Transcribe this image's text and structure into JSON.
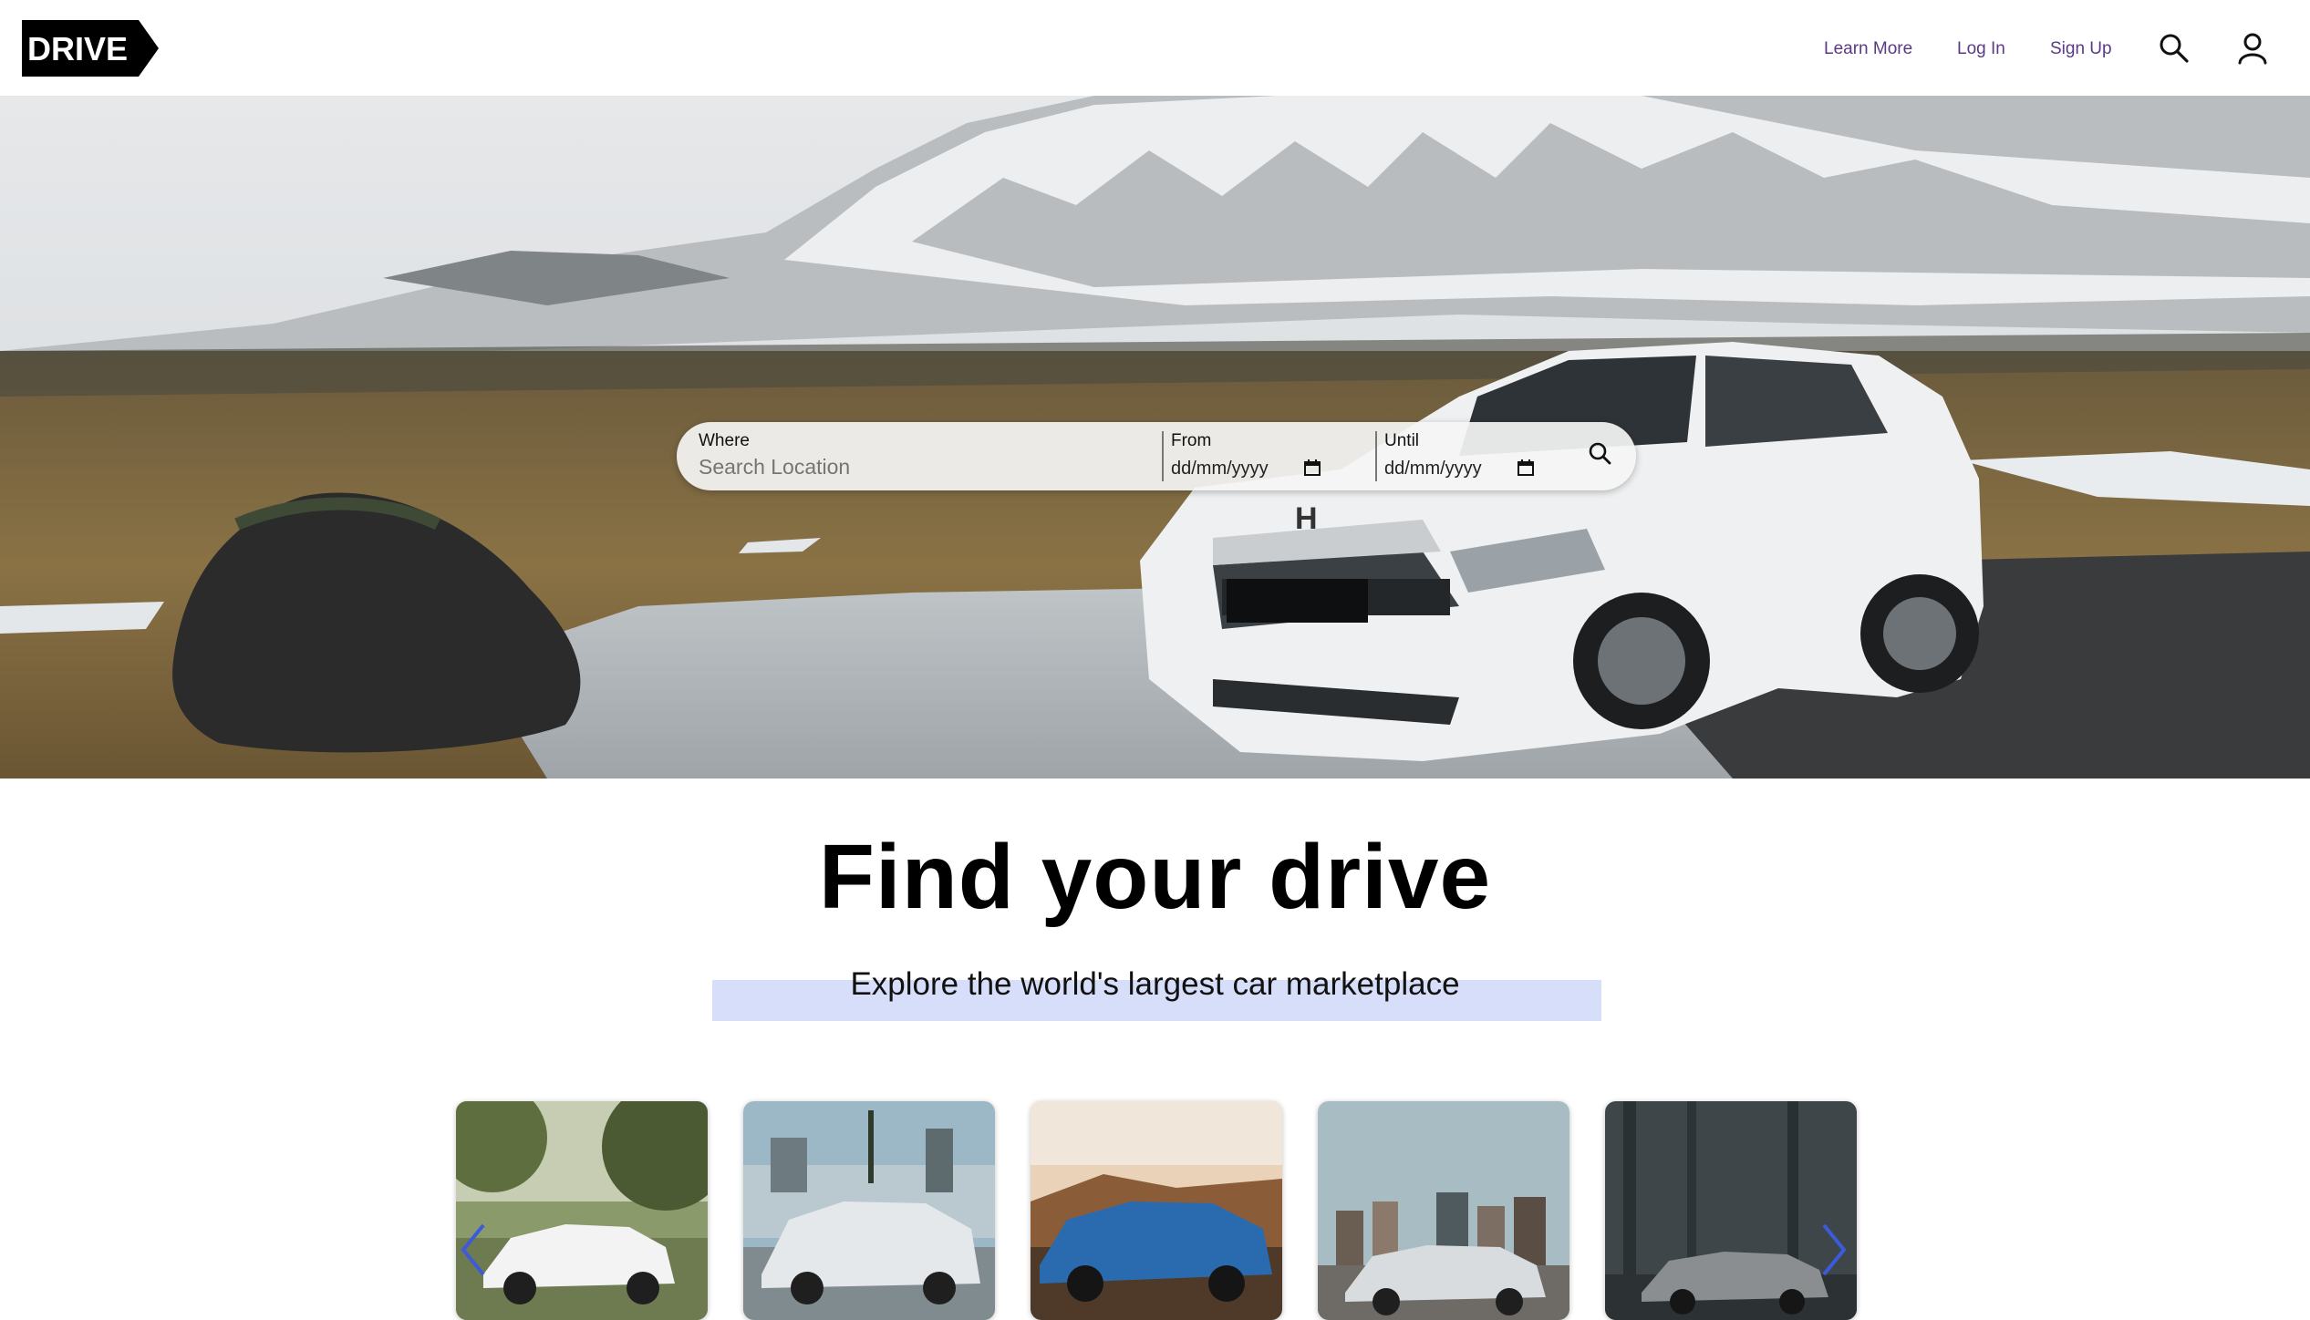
{
  "header": {
    "logo_text": "DRIVE",
    "nav": {
      "learn_more": "Learn More",
      "log_in": "Log In",
      "sign_up": "Sign Up"
    },
    "icons": [
      "search-icon",
      "user-icon"
    ],
    "link_color": "#5a3a86"
  },
  "search": {
    "where_label": "Where",
    "where_placeholder": "Search Location",
    "from_label": "From",
    "from_value": "dd/mm/yyyy",
    "until_label": "Until",
    "until_value": "dd/mm/yyyy",
    "icons": [
      "calendar-icon",
      "search-icon"
    ]
  },
  "hero": {
    "image": "white-honda-suv-snowy-landscape"
  },
  "main": {
    "title": "Find your drive",
    "subtitle": "Explore the world's largest car marketplace",
    "highlight_color": "#d6defa"
  },
  "carousel": {
    "cards": [
      {
        "image": "white-audi-suv-trees"
      },
      {
        "image": "silver-bmw-palms"
      },
      {
        "image": "blue-camaro-desert"
      },
      {
        "image": "silver-coupe-city-skyline"
      },
      {
        "image": "grey-nissan-dark-forest"
      }
    ],
    "icons": [
      "chevron-left-icon",
      "chevron-right-icon"
    ],
    "arrow_color": "#3b5bdb"
  }
}
